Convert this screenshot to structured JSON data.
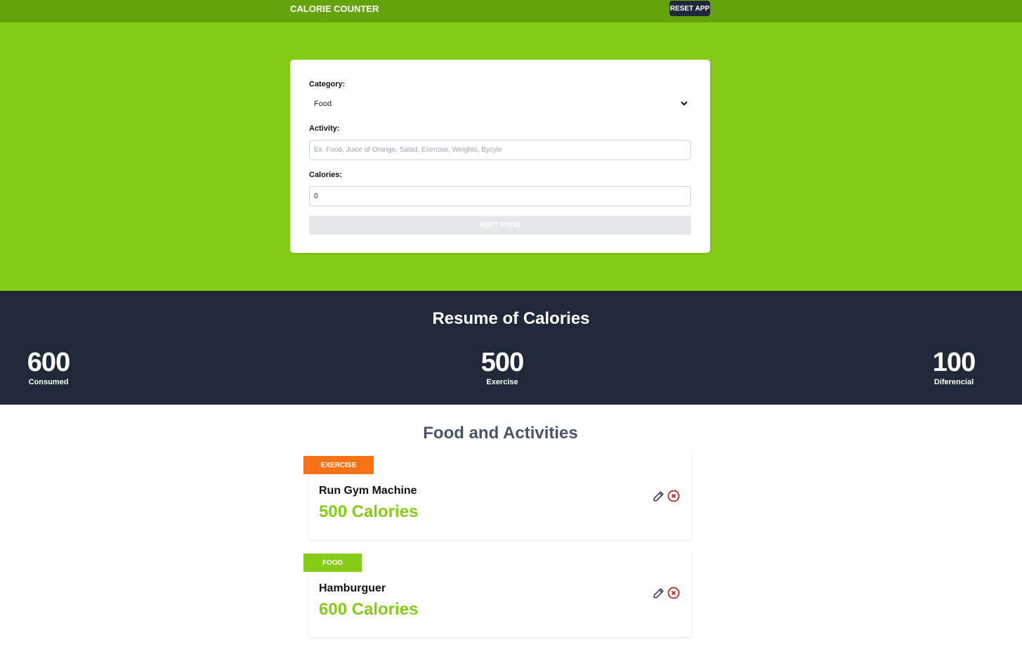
{
  "header": {
    "title": "CALORIE COUNTER",
    "reset_label": "RESET APP"
  },
  "form": {
    "category_label": "Category:",
    "category_value": "Food",
    "activity_label": "Activity:",
    "activity_placeholder": "Ex. Food, Juice of Orange, Salad, Exercise, Weights, Bycyle",
    "calories_label": "Calories:",
    "calories_value": "0",
    "submit_label": "KEPT FOOD"
  },
  "summary": {
    "heading": "Resume of Calories",
    "consumed": {
      "value": "600",
      "label": "Consumed"
    },
    "exercise": {
      "value": "500",
      "label": "Exercise"
    },
    "difference": {
      "value": "100",
      "label": "Diferencial"
    }
  },
  "list": {
    "heading": "Food and Activities",
    "items": [
      {
        "tag": "EXERCISE",
        "tag_color": "#f97316",
        "name": "Run Gym Machine",
        "calories": "500 Calories"
      },
      {
        "tag": "FOOD",
        "tag_color": "#84cc16",
        "name": "Hamburguer",
        "calories": "600 Calories"
      }
    ]
  },
  "colors": {
    "header": "#65a30d",
    "hero": "#84cc16",
    "summary": "#1f2937",
    "accent": "#84cc16",
    "exercise_tag": "#f97316",
    "delete_icon": "#b91c1c"
  }
}
